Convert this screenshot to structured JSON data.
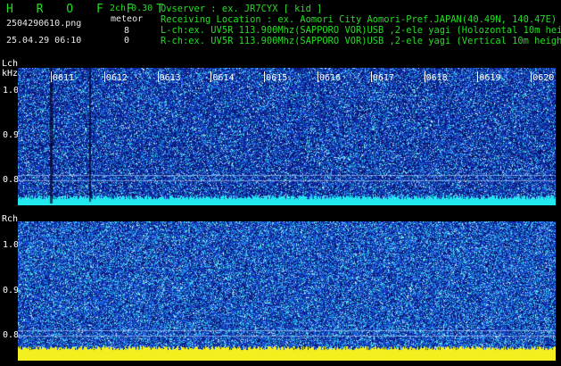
{
  "header": {
    "app_name": "H R O F F T",
    "mode": "2ch 0.30",
    "filename": "2504290610.png",
    "meteor_label": "meteor",
    "count_l": "8",
    "count_r": "0",
    "datetime": "25.04.29 06:10",
    "observer": "Ovserver             : ex. JR7CYX [ kid ]",
    "location": "Receiving Location : ex. Aomori City Aomori-Pref.JAPAN(40.49N, 140.47E)",
    "lch_info": "L-ch:ex. UV5R 113.900Mhz(SAPPORO VOR)USB ,2-ele yagi (Holozontal 10m height)",
    "rch_info": "R-ch:ex. UV5R 113.900Mhz(SAPPORO VOR)USB ,2-ele yagi (Vertical 10m height)"
  },
  "left_panel": {
    "label": "Lch",
    "unit": "kHz",
    "y_ticks": [
      "1.0",
      "0.9",
      "0.8"
    ]
  },
  "right_panel": {
    "label": "Rch",
    "y_ticks": [
      "1.0",
      "0.9",
      "0.8"
    ]
  },
  "time_ticks": [
    "0611",
    "0612",
    "0613",
    "0614",
    "0615",
    "0616",
    "0617",
    "0618",
    "0619",
    "0620"
  ],
  "colors": {
    "background": "#000000",
    "title_green": "#22dd22",
    "text_white": "#e8e8e8",
    "noise_dark": "#0a1a6e",
    "noise_blue": "#1e40c8",
    "noise_cyan": "#38b8e8",
    "baseline_l": "#22e8f0",
    "baseline_r": "#f4f020"
  }
}
